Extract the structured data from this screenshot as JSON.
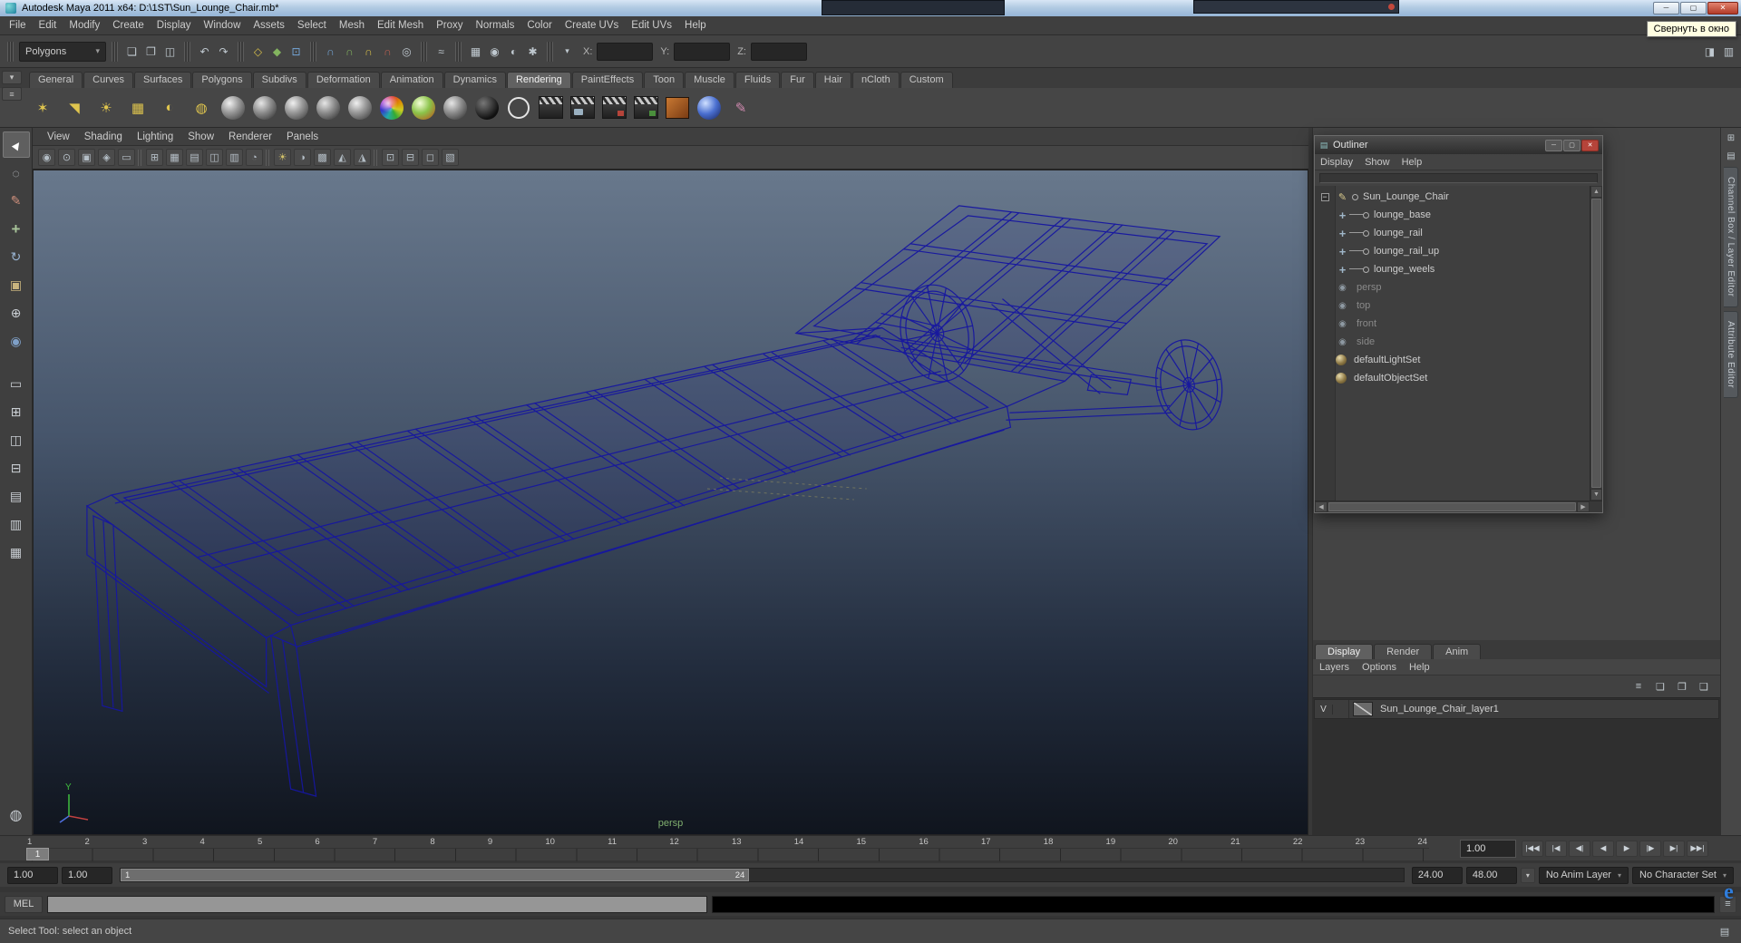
{
  "window": {
    "title": "Autodesk Maya 2011 x64: D:\\1ST\\Sun_Lounge_Chair.mb*",
    "tooltip": "Свернуть в окно",
    "buttons": {
      "minimize": "─",
      "maximize": "▢",
      "close": "✕"
    }
  },
  "menubar": {
    "items": [
      "File",
      "Edit",
      "Modify",
      "Create",
      "Display",
      "Window",
      "Assets",
      "Select",
      "Mesh",
      "Edit Mesh",
      "Proxy",
      "Normals",
      "Color",
      "Create UVs",
      "Edit UVs",
      "Help"
    ]
  },
  "status_line": {
    "mode_selector": "Polygons",
    "x_label": "X:",
    "y_label": "Y:",
    "z_label": "Z:",
    "x_value": "",
    "y_value": "",
    "z_value": ""
  },
  "shelf": {
    "tabs": [
      {
        "label": "General"
      },
      {
        "label": "Curves"
      },
      {
        "label": "Surfaces"
      },
      {
        "label": "Polygons"
      },
      {
        "label": "Subdivs"
      },
      {
        "label": "Deformation"
      },
      {
        "label": "Animation"
      },
      {
        "label": "Dynamics"
      },
      {
        "label": "Rendering",
        "cls": "active"
      },
      {
        "label": "PaintEffects"
      },
      {
        "label": "Toon"
      },
      {
        "label": "Muscle"
      },
      {
        "label": "Fluids"
      },
      {
        "label": "Fur"
      },
      {
        "label": "Hair"
      },
      {
        "label": "nCloth"
      },
      {
        "label": "Custom"
      }
    ]
  },
  "viewport": {
    "menu": [
      "View",
      "Shading",
      "Lighting",
      "Show",
      "Renderer",
      "Panels"
    ],
    "camera_label": "persp",
    "axis_y_label": "Y"
  },
  "outliner": {
    "title": "Outliner",
    "menu": [
      "Display",
      "Show",
      "Help"
    ],
    "buttons": {
      "minimize": "─",
      "maximize": "▢",
      "close": "✕"
    },
    "items": [
      {
        "label": "Sun_Lounge_Chair",
        "expander": "−",
        "cls": "xform"
      },
      {
        "label": "lounge_base",
        "cls": "child"
      },
      {
        "label": "lounge_rail",
        "cls": "child"
      },
      {
        "label": "lounge_rail_up",
        "cls": "child"
      },
      {
        "label": "lounge_weels",
        "cls": "child"
      },
      {
        "label": "persp",
        "cls": "muted"
      },
      {
        "label": "top",
        "cls": "muted"
      },
      {
        "label": "front",
        "cls": "muted"
      },
      {
        "label": "side",
        "cls": "muted"
      },
      {
        "label": "defaultLightSet",
        "cls": "set"
      },
      {
        "label": "defaultObjectSet",
        "cls": "set"
      }
    ]
  },
  "layer_editor": {
    "tabs": [
      {
        "label": "Display",
        "cls": "active"
      },
      {
        "label": "Render"
      },
      {
        "label": "Anim"
      }
    ],
    "menu": [
      "Layers",
      "Options",
      "Help"
    ],
    "layers": [
      {
        "visibility": "V",
        "name": "Sun_Lounge_Chair_layer1"
      }
    ]
  },
  "side_tabs": [
    "Channel Box / Layer Editor",
    "Attribute Editor"
  ],
  "timeline": {
    "frames": [
      "1",
      "2",
      "3",
      "4",
      "5",
      "6",
      "7",
      "8",
      "9",
      "10",
      "11",
      "12",
      "13",
      "14",
      "15",
      "16",
      "17",
      "18",
      "19",
      "20",
      "21",
      "22",
      "23",
      "24"
    ],
    "current_frame": "1",
    "current_time": "1.00",
    "transport": [
      "|◀◀",
      "|◀",
      "◀|",
      "◀",
      "▶",
      "|▶",
      "▶|",
      "▶▶|"
    ]
  },
  "range_slider": {
    "anim_start": "1.00",
    "playback_start": "1.00",
    "range_start": "1",
    "range_end": "24",
    "playback_end": "24.00",
    "anim_end": "48.00",
    "anim_layer": "No Anim Layer",
    "character_set": "No Character Set"
  },
  "command_line": {
    "label": "MEL"
  },
  "help_line": {
    "text": "Select Tool: select an object"
  },
  "colors": {
    "wireframe": "#1616a0",
    "viewport_top": "#68788c",
    "viewport_bottom": "#10151e",
    "close_button": "#b5443a"
  },
  "icons": {
    "status": [
      "new-scene",
      "open-scene",
      "save-scene",
      "undo",
      "redo",
      "select-hierarchy",
      "select-object",
      "select-component",
      "snap-grid",
      "snap-curve",
      "snap-point",
      "snap-view-plane",
      "make-live",
      "construction-history",
      "render-view",
      "render-current-frame",
      "ipr-render",
      "render-settings",
      "show-channel-box",
      "show-attribute-editor"
    ],
    "toolbox": [
      "select-tool",
      "lasso-select-tool",
      "paint-select-tool",
      "move-tool",
      "rotate-tool",
      "scale-tool",
      "universal-manipulator-tool",
      "soft-mod-tool",
      "layout-single-pane",
      "layout-four-pane",
      "layout-two-side",
      "layout-two-stack",
      "layout-persp-outliner",
      "layout-hypergraph",
      "layout-multi",
      "hotbox"
    ],
    "shelf": [
      "point-light",
      "spot-light",
      "directional-light",
      "area-light",
      "ambient-light",
      "volume-light",
      "lambert-material",
      "blinn-material",
      "phong-material",
      "phong-e-material",
      "anisotropic-material",
      "rainbow-ramp-material",
      "ocean-shader",
      "layered-shader",
      "black-surface-shader",
      "use-background-shader",
      "render-globals",
      "render-view",
      "ipr-render",
      "batch-render",
      "hypershade",
      "texture-swatch",
      "env-ball",
      "paint-effects"
    ],
    "viewport_bar": [
      "select-camera",
      "lock-camera",
      "camera-attributes",
      "bookmark",
      "image-plane",
      "2d-pan-zoom",
      "grid",
      "film-gate",
      "resolution-gate",
      "gate-mask",
      "field-chart",
      "safe-action",
      "safe-title",
      "fill-mode",
      "lights",
      "shadows",
      "textures",
      "wireframe-on-shaded",
      "xray",
      "isolate-select"
    ]
  }
}
